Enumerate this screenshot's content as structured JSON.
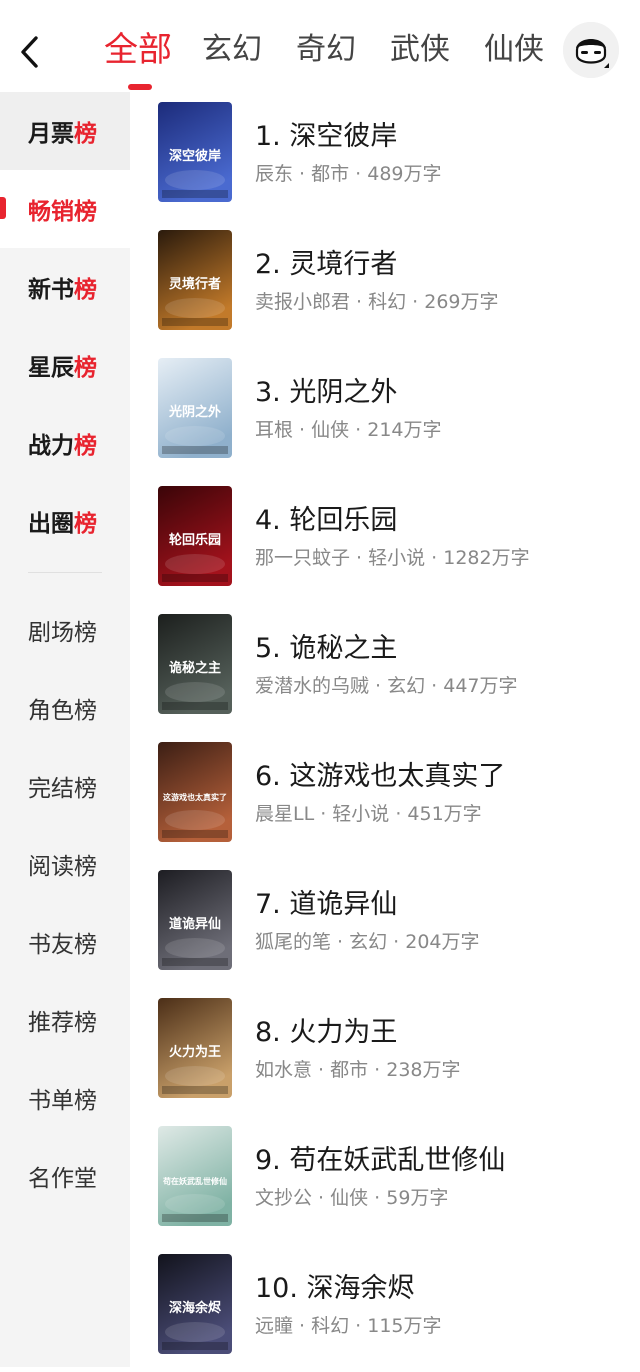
{
  "header": {
    "back_icon": "chevron-left-icon",
    "tabs": [
      "全部",
      "玄幻",
      "奇幻",
      "武侠",
      "仙侠"
    ],
    "active_tab": "全部",
    "avatar_icon": "avatar-icon"
  },
  "sidebar": {
    "ranked": [
      {
        "pre": "月票",
        "accent": "榜"
      },
      {
        "pre": "畅销",
        "accent": "榜"
      },
      {
        "pre": "新书",
        "accent": "榜"
      },
      {
        "pre": "星辰",
        "accent": "榜"
      },
      {
        "pre": "战力",
        "accent": "榜"
      },
      {
        "pre": "出圈",
        "accent": "榜"
      }
    ],
    "active_index": 1,
    "others": [
      "剧场榜",
      "角色榜",
      "完结榜",
      "阅读榜",
      "书友榜",
      "推荐榜",
      "书单榜",
      "名作堂"
    ]
  },
  "books": [
    {
      "title": "1. 深空彼岸",
      "meta": "辰东 · 都市 · 489万字",
      "cover_text": "深空彼岸",
      "cover_colors": [
        "#1c2b7a",
        "#4a6ad0"
      ]
    },
    {
      "title": "2. 灵境行者",
      "meta": "卖报小郎君 · 科幻 · 269万字",
      "cover_text": "灵境行者",
      "cover_colors": [
        "#2a1a0c",
        "#c27a2a"
      ]
    },
    {
      "title": "3. 光阴之外",
      "meta": "耳根 · 仙侠 · 214万字",
      "cover_text": "光阴之外",
      "cover_colors": [
        "#e6eef5",
        "#8fb0cc"
      ]
    },
    {
      "title": "4. 轮回乐园",
      "meta": "那一只蚊子 · 轻小说 · 1282万字",
      "cover_text": "轮回乐园",
      "cover_colors": [
        "#3a0508",
        "#a3121c"
      ]
    },
    {
      "title": "5. 诡秘之主",
      "meta": "爱潜水的乌贼 · 玄幻 · 447万字",
      "cover_text": "诡秘之主",
      "cover_colors": [
        "#1c1f1d",
        "#55605a"
      ]
    },
    {
      "title": "6. 这游戏也太真实了",
      "meta": "晨星LL · 轻小说 · 451万字",
      "cover_text": "这游戏也太真实了",
      "cover_colors": [
        "#3b1e14",
        "#b5603a"
      ]
    },
    {
      "title": "7. 道诡异仙",
      "meta": "狐尾的笔 · 玄幻 · 204万字",
      "cover_text": "道诡异仙",
      "cover_colors": [
        "#1d1d22",
        "#6e6e78"
      ]
    },
    {
      "title": "8. 火力为王",
      "meta": "如水意 · 都市 · 238万字",
      "cover_text": "火力为王",
      "cover_colors": [
        "#4b2e17",
        "#c9a06a"
      ]
    },
    {
      "title": "9. 苟在妖武乱世修仙",
      "meta": "文抄公 · 仙侠 · 59万字",
      "cover_text": "苟在妖武乱世修仙",
      "cover_colors": [
        "#dfe9e6",
        "#7fb2a4"
      ]
    },
    {
      "title": "10. 深海余烬",
      "meta": "远瞳 · 科幻 · 115万字",
      "cover_text": "深海余烬",
      "cover_colors": [
        "#12131c",
        "#4b4d78"
      ]
    }
  ]
}
